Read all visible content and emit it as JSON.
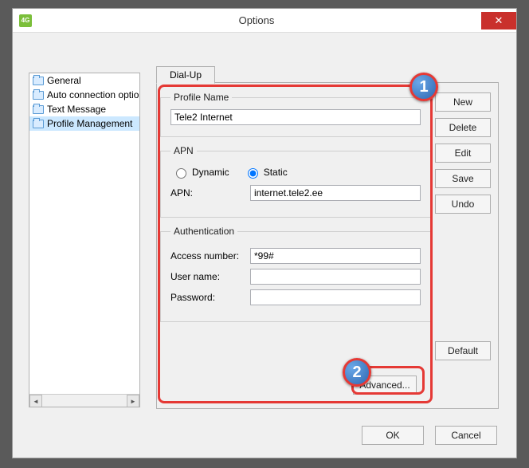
{
  "window": {
    "title": "Options",
    "icon_label": "4G"
  },
  "sidebar": {
    "items": [
      {
        "label": "General"
      },
      {
        "label": "Auto connection options"
      },
      {
        "label": "Text Message"
      },
      {
        "label": "Profile Management"
      }
    ]
  },
  "tab": {
    "label": "Dial-Up"
  },
  "profile": {
    "legend": "Profile Name",
    "value": "Tele2 Internet"
  },
  "apn": {
    "legend": "APN",
    "dynamic_label": "Dynamic",
    "static_label": "Static",
    "selected": "static",
    "field_label": "APN:",
    "value": "internet.tele2.ee"
  },
  "auth": {
    "legend": "Authentication",
    "access_label": "Access number:",
    "access_value": "*99#",
    "user_label": "User name:",
    "user_value": "",
    "pass_label": "Password:",
    "pass_value": ""
  },
  "buttons": {
    "new": "New",
    "delete": "Delete",
    "edit": "Edit",
    "save": "Save",
    "undo": "Undo",
    "default": "Default",
    "advanced": "Advanced...",
    "ok": "OK",
    "cancel": "Cancel"
  },
  "callouts": {
    "one": "1",
    "two": "2"
  }
}
